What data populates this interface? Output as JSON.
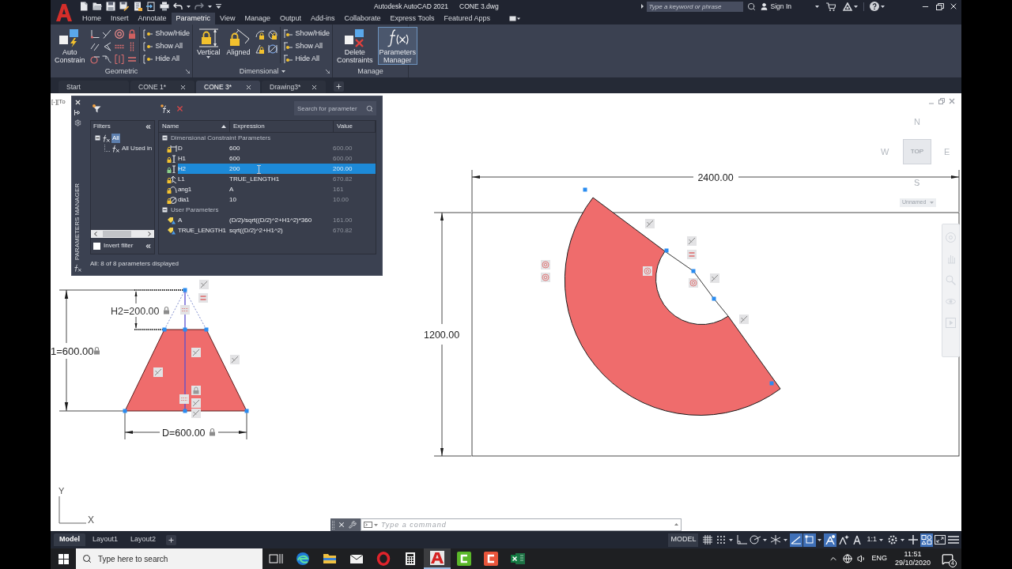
{
  "title_bar": {
    "app": "Autodesk AutoCAD 2021",
    "file": "CONE 3.dwg",
    "search": {
      "placeholder": "Type a keyword or phrase"
    },
    "sign_in": "Sign In"
  },
  "ribbon_tabs": [
    {
      "label": "Home",
      "selected": false
    },
    {
      "label": "Insert",
      "selected": false
    },
    {
      "label": "Annotate",
      "selected": false
    },
    {
      "label": "Parametric",
      "selected": true
    },
    {
      "label": "View",
      "selected": false
    },
    {
      "label": "Manage",
      "selected": false
    },
    {
      "label": "Output",
      "selected": false
    },
    {
      "label": "Add-ins",
      "selected": false
    },
    {
      "label": "Collaborate",
      "selected": false
    },
    {
      "label": "Express Tools",
      "selected": false
    },
    {
      "label": "Featured Apps",
      "selected": false
    }
  ],
  "ribbon_panels": [
    {
      "label": "Geometric",
      "kind": "geometric",
      "dropdown": false,
      "launcher": true,
      "large_buttons": [
        {
          "label": "Auto Constrain",
          "kind": "auto-constrain",
          "selected": false,
          "dropdown": false
        }
      ],
      "toggles": [
        "Show/Hide",
        "Show All",
        "Hide All"
      ]
    },
    {
      "label": "Dimensional",
      "kind": "dimensional",
      "dropdown": true,
      "launcher": true,
      "large_buttons": [
        {
          "label": "Vertical",
          "kind": "vertical",
          "selected": false,
          "dropdown": true
        },
        {
          "label": "Aligned",
          "kind": "aligned",
          "selected": false,
          "dropdown": false
        }
      ],
      "toggles": [
        "Show/Hide",
        "Show All",
        "Hide All"
      ]
    },
    {
      "label": "Manage",
      "kind": "manage",
      "dropdown": false,
      "launcher": false,
      "large_buttons": [
        {
          "label": "Delete Constraints",
          "kind": "delete",
          "selected": false,
          "dropdown": false
        },
        {
          "label": "Parameters Manager",
          "kind": "function",
          "selected": true,
          "dropdown": false
        }
      ]
    }
  ],
  "file_tabs": [
    {
      "label": "Start",
      "selected": false,
      "closable": false
    },
    {
      "label": "CONE 1*",
      "selected": false,
      "closable": true
    },
    {
      "label": "CONE 3*",
      "selected": true,
      "closable": true
    },
    {
      "label": "Drawing3*",
      "selected": false,
      "closable": true
    }
  ],
  "viewport_label": "[-][To",
  "parameters_manager": {
    "title": "PARAMETERS MANAGER",
    "search": {
      "placeholder": "Search for parameter"
    },
    "filters": {
      "heading": "Filters",
      "tree": [
        {
          "label": "All",
          "selected": true,
          "expanded": true,
          "children": [
            {
              "label": "All Used in",
              "selected": false
            }
          ]
        }
      ],
      "invert_filter": {
        "label": "Invert filter",
        "checked": false
      }
    },
    "columns": [
      {
        "label": "Name",
        "sorted": true
      },
      {
        "label": "Expression",
        "sorted": false
      },
      {
        "label": "Value",
        "sorted": false
      }
    ],
    "groups": [
      {
        "label": "Dimensional Constraint Parameters",
        "expanded": true,
        "rows": [
          {
            "kind": "horizontal",
            "name": "D",
            "expression": "600",
            "value": "600.00",
            "selected": false
          },
          {
            "kind": "vertical",
            "name": "H1",
            "expression": "600",
            "value": "600.00",
            "selected": false
          },
          {
            "kind": "vertical",
            "name": "H2",
            "expression": "200",
            "value": "200.00",
            "selected": true
          },
          {
            "kind": "aligned",
            "name": "L1",
            "expression": "TRUE_LENGTH1",
            "value": "670.82",
            "selected": false
          },
          {
            "kind": "angular",
            "name": "ang1",
            "expression": "A",
            "value": "161",
            "selected": false
          },
          {
            "kind": "diameter",
            "name": "dia1",
            "expression": "10",
            "value": "10.00",
            "selected": false
          }
        ]
      },
      {
        "label": "User Parameters",
        "expanded": true,
        "rows": [
          {
            "kind": "user",
            "name": "A",
            "expression": "(D/2)/sqrt((D/2)^2+H1^2)*360",
            "value": "161.00",
            "selected": false
          },
          {
            "kind": "user",
            "name": "TRUE_LENGTH1",
            "expression": "sqrt((D/2)^2+H1^2)",
            "value": "670.82",
            "selected": false
          }
        ]
      }
    ],
    "status": "All: 8 of 8 parameters displayed"
  },
  "cone_sketch": {
    "height_label": "1=600.00",
    "top_label": "H2=200.00",
    "base_label": "D=600.00"
  },
  "sector_sketch": {
    "width_label": "2400.00",
    "height_label": "1200.00"
  },
  "view_cube": {
    "north": "N",
    "west": "W",
    "east": "E",
    "south": "S",
    "face": "TOP",
    "view_name": "Unnamed"
  },
  "ucs": {
    "x": "X",
    "y": "Y"
  },
  "command_line": {
    "placeholder": "Type a command"
  },
  "layout_tabs": [
    {
      "label": "Model",
      "selected": true
    },
    {
      "label": "Layout1",
      "selected": false
    },
    {
      "label": "Layout2",
      "selected": false
    }
  ],
  "status_bar": {
    "space": "MODEL",
    "toggles": [
      {
        "kind": "grid",
        "on": false,
        "menu": false
      },
      {
        "kind": "snap",
        "on": false,
        "menu": true
      },
      {
        "kind": "ortho",
        "on": false,
        "menu": false
      },
      {
        "kind": "polar",
        "on": false,
        "menu": true
      },
      {
        "kind": "isodraft",
        "on": false,
        "menu": true
      },
      {
        "kind": "otrack",
        "on": true,
        "menu": false
      },
      {
        "kind": "osnap",
        "on": true,
        "menu": true
      },
      {
        "kind": "annotation",
        "on": true,
        "menu": false
      },
      {
        "kind": "autoscale",
        "on": false,
        "menu": false
      },
      {
        "kind": "annoscale",
        "on": false,
        "menu": false
      }
    ],
    "scale": "1:1",
    "tools": [
      {
        "kind": "gear",
        "on": false,
        "menu": true
      },
      {
        "kind": "plus",
        "on": false,
        "menu": false
      },
      {
        "kind": "isolate",
        "on": true,
        "menu": false
      },
      {
        "kind": "fullscreen",
        "on": false,
        "menu": false
      },
      {
        "kind": "menu",
        "on": false,
        "menu": false
      }
    ]
  },
  "taskbar": {
    "search": {
      "placeholder": "Type here to search"
    },
    "apps": [
      {
        "kind": "task-view",
        "selected": false
      },
      {
        "kind": "swirl",
        "selected": false
      },
      {
        "kind": "folder",
        "selected": false
      },
      {
        "kind": "envelope",
        "selected": false
      },
      {
        "kind": "ring",
        "selected": false
      },
      {
        "kind": "calculator",
        "selected": false
      },
      {
        "kind": "cad",
        "selected": true
      },
      {
        "kind": "recorder",
        "selected": false
      },
      {
        "kind": "recorder-alt",
        "selected": false
      },
      {
        "kind": "spreadsheet",
        "selected": false
      }
    ],
    "language": "ENG",
    "time": "11:51",
    "date": "29/10/2020",
    "notifications": "4"
  }
}
